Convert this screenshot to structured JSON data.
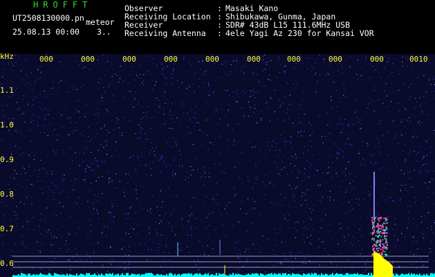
{
  "brand": "HROFFT",
  "file_name": "UT2508130000.pn",
  "meteor_label": "meteor",
  "date_time": "25.08.13 00:00",
  "count": "3..",
  "info": [
    {
      "label": "Observer",
      "value": "Masaki Kano"
    },
    {
      "label": "Receiving Location",
      "value": "Shibukawa, Gunma, Japan"
    },
    {
      "label": "Receiver",
      "value": "SDR# 43dB L15 111.6MHz USB"
    },
    {
      "label": "Receiving Antenna",
      "value": "4ele Yagi Az 230 for Kansai VOR"
    }
  ],
  "y_unit": "kHz",
  "y_ticks": [
    "1.1",
    "1.0",
    "0.9",
    "0.8",
    "0.7",
    "0.6"
  ],
  "x_ticks": [
    "000",
    "000",
    "000",
    "000",
    "000",
    "000",
    "000",
    "000",
    "000",
    "0010"
  ],
  "colors": {
    "background": "#0a0a2a",
    "noise": "#3a3aff",
    "baseline": "#00ffff",
    "echo": "#ffff00",
    "echo_core": "#ff3399",
    "text_green": "#33dd33",
    "text_yellow": "#ffff33"
  }
}
